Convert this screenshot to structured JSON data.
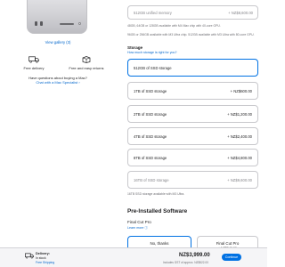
{
  "gallery": {
    "link": "View gallery (3)"
  },
  "services": [
    {
      "icon": "truck-icon",
      "label": "Free delivery"
    },
    {
      "icon": "box-icon",
      "label": "Free and easy returns"
    }
  ],
  "help": {
    "question": "Have questions about buying a Mac?",
    "chat_link": "Chat with a Mac Specialist ›"
  },
  "memory": {
    "option_label": "512GB unified memory",
    "option_price": "+ NZ$8,600.00",
    "note1": "48GB, 64GB or 128GB available with M4 Max chip with 40-core GPU.",
    "note2": "96GB or 256GB available with M3 Ultra chip. 512GB available with M3 Ultra with 80-core GPU."
  },
  "storage": {
    "title": "Storage",
    "help_link": "How much storage is right for you?",
    "options": [
      {
        "label": "512GB of SSD storage",
        "price": "",
        "selected": true
      },
      {
        "label": "1TB of SSD storage",
        "price": "+ NZ$600.00"
      },
      {
        "label": "2TB of SSD storage",
        "price": "+ NZ$1,200.00"
      },
      {
        "label": "4TB of SSD storage",
        "price": "+ NZ$2,400.00"
      },
      {
        "label": "8TB of SSD storage",
        "price": "+ NZ$4,800.00"
      },
      {
        "label": "16TB of SSD storage",
        "price": "+ NZ$9,600.00",
        "dim": true
      }
    ],
    "note": "16TB SSD storage available with M3 Ultra."
  },
  "software": {
    "title": "Pre-Installed Software",
    "fcp_title": "Final Cut Pro",
    "learn_link": "Learn more ⓘ",
    "choices": [
      {
        "label": "No, thanks",
        "price": ""
      },
      {
        "label": "Final Cut Pro",
        "price": "+ NZ$549.99"
      }
    ]
  },
  "bottom_bar": {
    "delivery_title": "Delivery:",
    "delivery_status": "In stock",
    "delivery_link": "Free Shipping",
    "total": "NZ$3,999.00",
    "gst": "Includes GST of approx. NZ$522.00",
    "continue_label": "Continue"
  },
  "colors": {
    "accent": "#0071e3",
    "link": "#0066cc",
    "text": "#1d1d1f",
    "border": "#c8c8cc"
  }
}
